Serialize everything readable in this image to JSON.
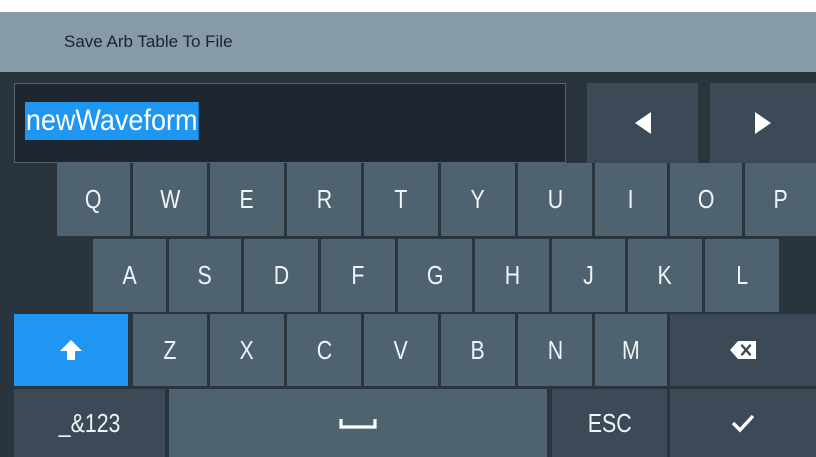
{
  "dialog": {
    "title": "Save Arb Table To File"
  },
  "input": {
    "value": "newWaveform",
    "selected": true
  },
  "navigation": {
    "left_icon": "triangle-left-icon",
    "right_icon": "triangle-right-icon"
  },
  "keyboard": {
    "row1": [
      "Q",
      "W",
      "E",
      "R",
      "T",
      "Y",
      "U",
      "I",
      "O",
      "P"
    ],
    "row2": [
      "A",
      "S",
      "D",
      "F",
      "G",
      "H",
      "J",
      "K",
      "L"
    ],
    "row3": [
      "Z",
      "X",
      "C",
      "V",
      "B",
      "N",
      "M"
    ],
    "shift_icon": "shift-up-arrow-icon",
    "shift_active": true,
    "backspace_icon": "backspace-icon",
    "symbols_label": "_&123",
    "space_icon": "space-bar-icon",
    "esc_label": "ESC",
    "enter_icon": "checkmark-icon"
  },
  "colors": {
    "background": "#2a343d",
    "title_bar": "#869aa8",
    "key": "#4f6270",
    "key_dark": "#3b4a56",
    "accent": "#1f96f2"
  }
}
